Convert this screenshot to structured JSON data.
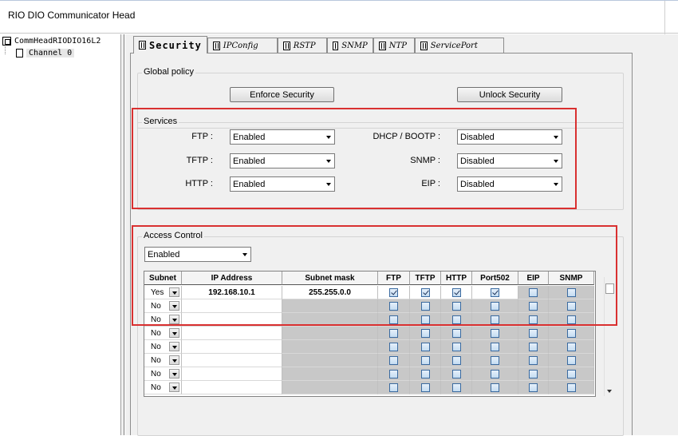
{
  "window": {
    "title": "RIO DIO Communicator Head"
  },
  "tree": {
    "root": "CommHeadRIODIO16L2",
    "child": "Channel 0"
  },
  "tabs": [
    "Security",
    "IPConfig",
    "RSTP",
    "SNMP",
    "NTP",
    "ServicePort"
  ],
  "global_policy": {
    "label": "Global policy",
    "enforce_button": "Enforce Security",
    "unlock_button": "Unlock Security"
  },
  "services": {
    "label": "Services",
    "items": [
      {
        "name": "FTP :",
        "value": "Enabled"
      },
      {
        "name": "TFTP :",
        "value": "Enabled"
      },
      {
        "name": "HTTP :",
        "value": "Enabled"
      },
      {
        "name": "DHCP / BOOTP :",
        "value": "Disabled"
      },
      {
        "name": "SNMP :",
        "value": "Disabled"
      },
      {
        "name": "EIP :",
        "value": "Disabled"
      }
    ]
  },
  "access_control": {
    "label": "Access Control",
    "state": "Enabled",
    "columns": [
      "Subnet",
      "IP Address",
      "Subnet mask",
      "FTP",
      "TFTP",
      "HTTP",
      "Port502",
      "EIP",
      "SNMP"
    ],
    "rows": [
      {
        "subnet": "Yes",
        "ip": "192.168.10.1",
        "mask": "255.255.0.0",
        "ftp": true,
        "tftp": true,
        "http": true,
        "port502": true,
        "eip": false,
        "snmp": false
      },
      {
        "subnet": "No",
        "ip": "",
        "mask": "",
        "ftp": false,
        "tftp": false,
        "http": false,
        "port502": false,
        "eip": false,
        "snmp": false
      },
      {
        "subnet": "No",
        "ip": "",
        "mask": "",
        "ftp": false,
        "tftp": false,
        "http": false,
        "port502": false,
        "eip": false,
        "snmp": false
      },
      {
        "subnet": "No",
        "ip": "",
        "mask": "",
        "ftp": false,
        "tftp": false,
        "http": false,
        "port502": false,
        "eip": false,
        "snmp": false
      },
      {
        "subnet": "No",
        "ip": "",
        "mask": "",
        "ftp": false,
        "tftp": false,
        "http": false,
        "port502": false,
        "eip": false,
        "snmp": false
      },
      {
        "subnet": "No",
        "ip": "",
        "mask": "",
        "ftp": false,
        "tftp": false,
        "http": false,
        "port502": false,
        "eip": false,
        "snmp": false
      },
      {
        "subnet": "No",
        "ip": "",
        "mask": "",
        "ftp": false,
        "tftp": false,
        "http": false,
        "port502": false,
        "eip": false,
        "snmp": false
      },
      {
        "subnet": "No",
        "ip": "",
        "mask": "",
        "ftp": false,
        "tftp": false,
        "http": false,
        "port502": false,
        "eip": false,
        "snmp": false
      }
    ]
  },
  "colors": {
    "highlight_box": "#d93030",
    "disabled_cell": "#c8c8c8"
  }
}
